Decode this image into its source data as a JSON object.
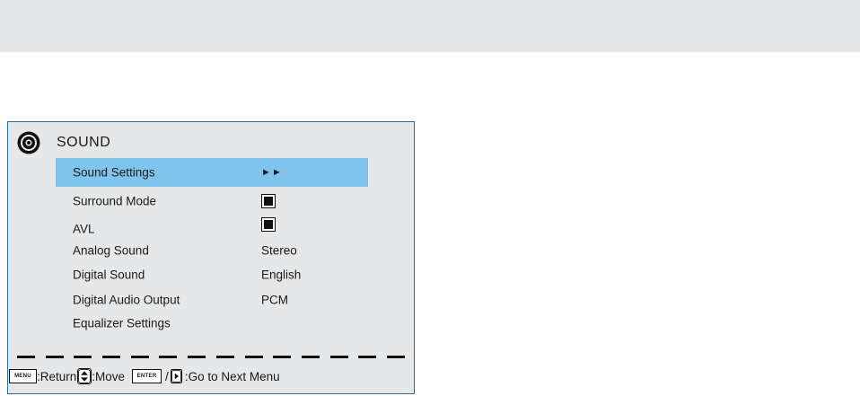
{
  "menu": {
    "title": "SOUND",
    "items": [
      {
        "label": "Sound Settings",
        "value": "►►",
        "type": "submenu",
        "selected": true
      },
      {
        "label": "Surround Mode",
        "value": "",
        "type": "checkbox",
        "checked": true
      },
      {
        "label": "AVL",
        "value": "",
        "type": "checkbox",
        "checked": true
      },
      {
        "label": "Analog Sound",
        "value": "Stereo",
        "type": "text"
      },
      {
        "label": "Digital Sound",
        "value": "English",
        "type": "text"
      },
      {
        "label": "Digital Audio Output",
        "value": "PCM",
        "type": "text"
      },
      {
        "label": "Equalizer Settings",
        "value": "",
        "type": "text"
      }
    ]
  },
  "hints": {
    "menu_key": "MENU",
    "return_text": ":Return",
    "move_text": ":Move",
    "enter_key": "ENTER",
    "slash": "/",
    "next_text": ":Go to Next Menu"
  },
  "colors": {
    "panel_bg": "#e6e7e8",
    "panel_border": "#2e6e9e",
    "highlight": "#7fc4ec"
  },
  "icons": [
    "speaker-icon",
    "menu-key-icon",
    "up-down-arrow-icon",
    "enter-key-icon",
    "right-arrow-icon"
  ]
}
